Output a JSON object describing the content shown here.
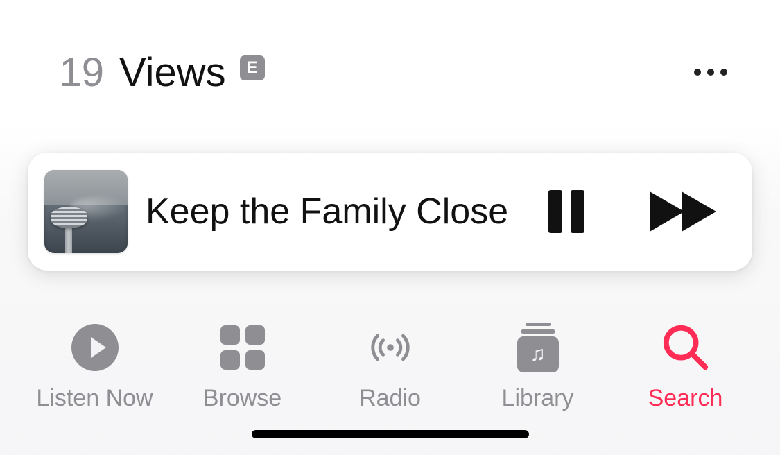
{
  "tracks": [
    {
      "number": "19",
      "title": "Views",
      "explicit": "E"
    }
  ],
  "now_playing": {
    "title": "Keep the Family Close"
  },
  "tabs": {
    "listen_now": "Listen Now",
    "browse": "Browse",
    "radio": "Radio",
    "library": "Library",
    "search": "Search"
  },
  "colors": {
    "accent": "#ff2d55",
    "inactive": "#8e8e93"
  }
}
